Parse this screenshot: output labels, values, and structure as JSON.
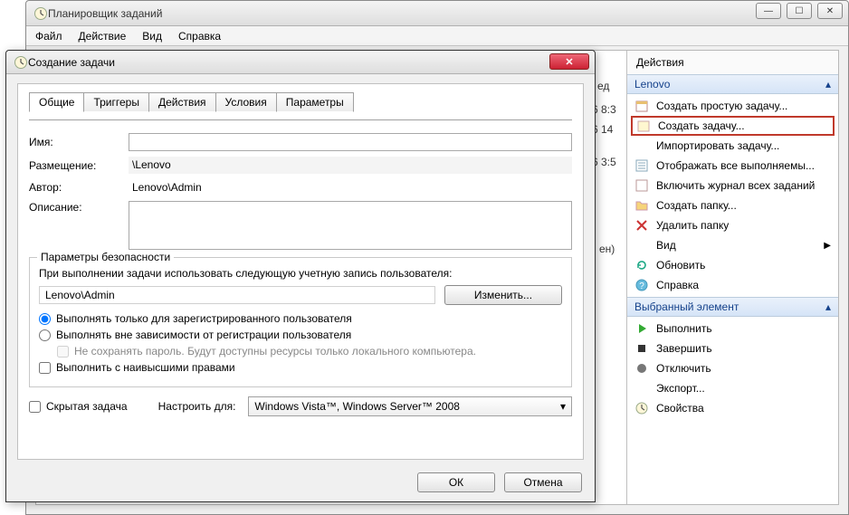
{
  "main": {
    "title": "Планировщик заданий",
    "menu": {
      "file": "Файл",
      "action": "Действие",
      "view": "Вид",
      "help": "Справка"
    }
  },
  "bg": {
    "col_head": "ед",
    "t1": "6 8:3",
    "t2": "6 14",
    "t3": "6 3:5",
    "status": "ен)"
  },
  "actions": {
    "header": "Действия",
    "section1": "Lenovo",
    "items1": {
      "create_basic": "Создать простую задачу...",
      "create_task": "Создать задачу...",
      "import": "Импортировать задачу...",
      "show_running": "Отображать все выполняемы...",
      "enable_history": "Включить журнал всех заданий",
      "new_folder": "Создать папку...",
      "delete_folder": "Удалить папку",
      "view": "Вид",
      "refresh": "Обновить",
      "help": "Справка"
    },
    "section2": "Выбранный элемент",
    "items2": {
      "run": "Выполнить",
      "end": "Завершить",
      "disable": "Отключить",
      "export": "Экспорт...",
      "properties": "Свойства",
      "delete": ""
    }
  },
  "dialog": {
    "title": "Создание задачи",
    "tabs": {
      "general": "Общие",
      "triggers": "Триггеры",
      "actions": "Действия",
      "conditions": "Условия",
      "settings": "Параметры"
    },
    "labels": {
      "name": "Имя:",
      "location": "Размещение:",
      "author": "Автор:",
      "description": "Описание:"
    },
    "values": {
      "name": "",
      "location": "\\Lenovo",
      "author": "Lenovo\\Admin",
      "description": ""
    },
    "security": {
      "legend": "Параметры безопасности",
      "account_label": "При выполнении задачи использовать следующую учетную запись пользователя:",
      "account": "Lenovo\\Admin",
      "change_btn": "Изменить...",
      "opt_logged_on": "Выполнять только для зарегистрированного пользователя",
      "opt_any": "Выполнять вне зависимости от регистрации пользователя",
      "opt_nopass": "Не сохранять пароль. Будут доступны ресурсы только локального компьютера.",
      "opt_highest": "Выполнить с наивысшими правами"
    },
    "bottom": {
      "hidden": "Скрытая задача",
      "configure_for": "Настроить для:",
      "configure_value": "Windows Vista™, Windows Server™ 2008"
    },
    "buttons": {
      "ok": "ОК",
      "cancel": "Отмена"
    }
  }
}
